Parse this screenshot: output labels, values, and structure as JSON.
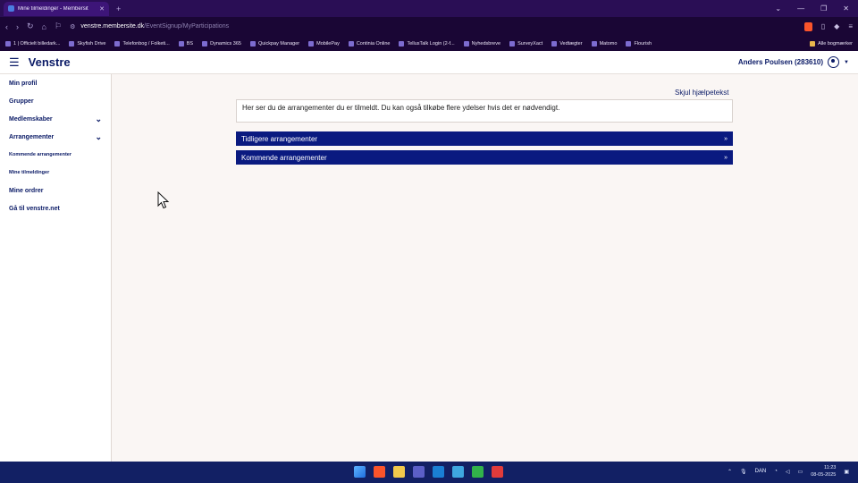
{
  "browser": {
    "tab_title": "Mine tilmeldinger - Membersit",
    "url_host": "venstre.membersite.dk",
    "url_path": "/EventSignup/MyParticipations",
    "bookmarks": [
      "1 | Officielt billedark...",
      "Skyfish Drive",
      "Telefonbog / Folketi...",
      "BS",
      "Dynamics 365",
      "Quickpay Manager",
      "MobilePay",
      "Continia Online",
      "TellusTalk Login (2-f...",
      "Nyhedsbreve",
      "SurveyXact",
      "Vedtægter",
      "Matomo",
      "Flourish"
    ],
    "bookmarks_folder": "Alle bogmærker"
  },
  "header": {
    "logo": "Venstre",
    "user": "Anders Poulsen (283610)"
  },
  "sidebar": {
    "items": [
      {
        "label": "Min profil"
      },
      {
        "label": "Grupper"
      },
      {
        "label": "Medlemskaber"
      },
      {
        "label": "Arrangementer"
      },
      {
        "label": "Kommende arrangementer"
      },
      {
        "label": "Mine tilmeldinger"
      },
      {
        "label": "Mine ordrer"
      },
      {
        "label": "Gå til venstre.net"
      }
    ]
  },
  "main": {
    "help_link": "Skjul hjælpetekst",
    "info_text": "Her ser du de arrangementer du er tilmeldt. Du kan også tilkøbe flere ydelser hvis det er nødvendigt.",
    "sections": [
      {
        "label": "Tidligere arrangementer",
        "arrow": "»"
      },
      {
        "label": "Kommende arrangementer",
        "arrow": "»"
      }
    ]
  },
  "taskbar": {
    "language": "DAN",
    "time": "11:23",
    "date": "08-05-2025"
  },
  "colors": {
    "brand": "#0a1a80",
    "chrome": "#2a0e55",
    "taskbar": "#122064"
  }
}
